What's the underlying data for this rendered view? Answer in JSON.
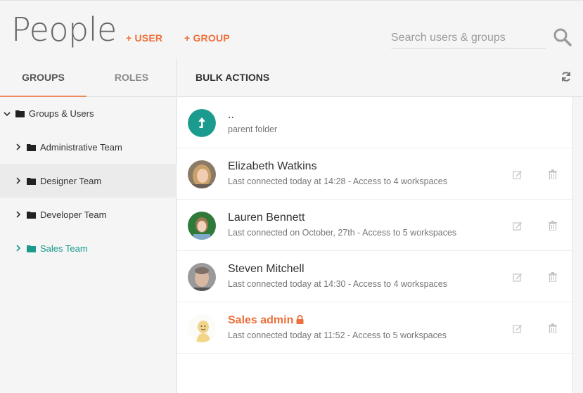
{
  "header": {
    "title": "People",
    "add_user_label": "+ USER",
    "add_group_label": "+ GROUP",
    "search_placeholder": "Search users & groups"
  },
  "sidebar": {
    "tabs": [
      {
        "label": "GROUPS",
        "active": true
      },
      {
        "label": "ROLES",
        "active": false
      }
    ],
    "tree": [
      {
        "label": "Groups & Users",
        "expanded": true
      },
      {
        "label": "Administrative Team"
      },
      {
        "label": "Designer Team",
        "selected": true
      },
      {
        "label": "Developer Team"
      },
      {
        "label": "Sales Team",
        "active": true
      }
    ]
  },
  "main": {
    "bulk_actions_label": "BULK ACTIONS",
    "parent": {
      "title": "..",
      "subtitle": "parent folder"
    },
    "users": [
      {
        "name": "Elizabeth Watkins",
        "status": "Last connected today at 14:28 - Access to 4 workspaces"
      },
      {
        "name": "Lauren Bennett",
        "status": "Last connected on October, 27th - Access to 5 workspaces"
      },
      {
        "name": "Steven Mitchell",
        "status": "Last connected today at 14:30 - Access to 4 workspaces"
      },
      {
        "name": "Sales admin",
        "status": "Last connected today at 11:52 - Access to 5 workspaces",
        "locked": true
      }
    ]
  },
  "colors": {
    "accent": "#ee6f3b",
    "teal": "#1a9b8e",
    "tab_underline": "#ee8b5e"
  },
  "icons": [
    "search-icon",
    "refresh-icon",
    "chevron-down-icon",
    "chevron-right-icon",
    "folder-icon",
    "parent-folder-icon",
    "edit-icon",
    "trash-icon",
    "lock-icon"
  ]
}
